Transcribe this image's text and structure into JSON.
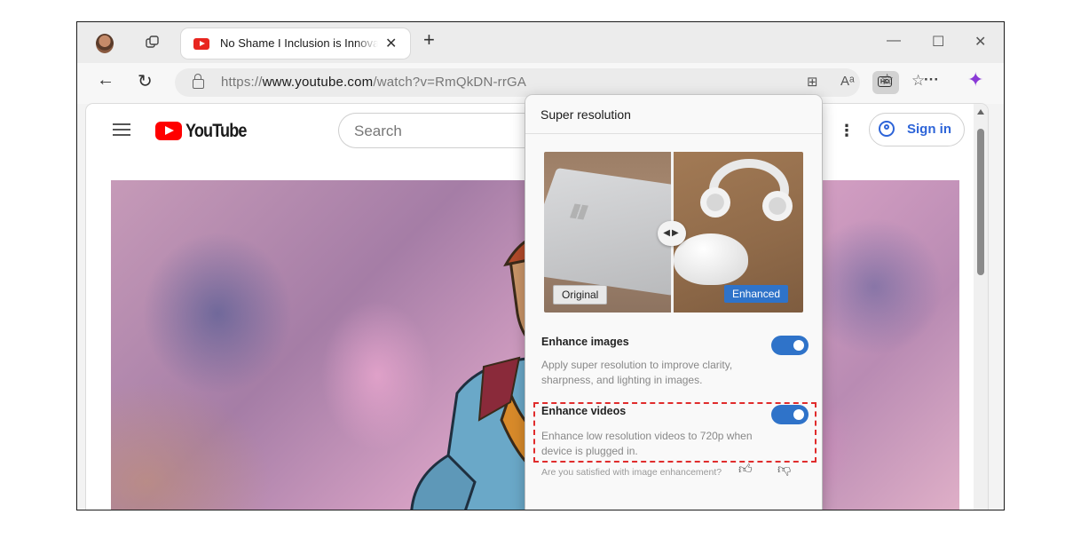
{
  "browser": {
    "tab": {
      "title": "No Shame I Inclusion is Innovation",
      "close_glyph": "✕"
    },
    "new_tab_glyph": "+",
    "window_controls": {
      "minimize": "—",
      "maximize": "☐",
      "close": "✕"
    },
    "nav": {
      "back": "←",
      "refresh": "↻"
    },
    "address": {
      "prefix": "https://",
      "host": "www.youtube.com",
      "path": "/watch?v=RmQkDN-rrGA"
    },
    "toolbar_icons": [
      "apps-icon",
      "read-aloud-icon",
      "hd-icon",
      "favorites-add-icon",
      "favorites-icon",
      "more-icon",
      "copilot-icon"
    ],
    "more_glyph": "···",
    "read_aloud_glyph": "Aᵃ",
    "apps_glyph": "⊞"
  },
  "youtube": {
    "logo_text": "YouTube",
    "search_placeholder": "Search",
    "kebab_glyph": "⋮",
    "sign_in_label": "Sign in"
  },
  "flyout": {
    "title": "Super resolution",
    "preview": {
      "original_label": "Original",
      "enhanced_label": "Enhanced"
    },
    "enhance_images": {
      "title": "Enhance images",
      "description": "Apply super resolution to improve clarity, sharpness, and lighting in images.",
      "enabled": true
    },
    "enhance_videos": {
      "title": "Enhance videos",
      "description": "Enhance low resolution videos to 720p when device is plugged in.",
      "enabled": true
    },
    "feedback_text": "Are you satisfied with image enhancement?"
  },
  "colors": {
    "accent": "#2f73c9",
    "highlight_border": "#e02c2c",
    "youtube_red": "#ff0000",
    "copilot_purple": "#8a3ad6"
  }
}
